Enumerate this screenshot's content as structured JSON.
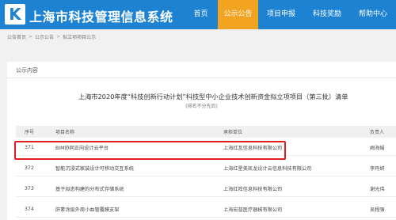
{
  "header": {
    "logo_letter": "K",
    "site_title": "上海市科技管理信息系统",
    "nav": [
      {
        "label": "首页",
        "active": false
      },
      {
        "label": "公示公告",
        "active": true
      },
      {
        "label": "项目申报",
        "active": false
      },
      {
        "label": "科技奖励",
        "active": false
      },
      {
        "label": "帮助中心",
        "active": false
      }
    ]
  },
  "breadcrumb": [
    "公告首页",
    "公示公告",
    "拟立项项目公示"
  ],
  "panel": {
    "title": "公示内容",
    "doc_title": "上海市2020年度“科技创新行动计划”科技型中小企业技术创新资金拟立项项目（第三批）清单",
    "doc_subtitle": "(排名不分先后)"
  },
  "table": {
    "headers": [
      "序号",
      "项目名称",
      "承担单位",
      "负责人"
    ],
    "rows": [
      {
        "num": "371",
        "name": "BIM协同正向设计云平台",
        "unit": "上海红瓦信息科技有限公司",
        "lead": "阙海娟"
      },
      {
        "num": "372",
        "name": "智能沉浸式家装设计可移动交互系统",
        "unit": "上海红星美凯龙设计云信息科技有限公司",
        "lead": "李丹妍"
      },
      {
        "num": "373",
        "name": "基于拟态构建的分布式存储系统",
        "unit": "上海红阵信息科技有限公司",
        "lead": "谢光伟"
      },
      {
        "num": "374",
        "name": "肝素涂层外周小血管覆膜支架",
        "unit": "上海宏普医疗器械有限公司",
        "lead": "吴程强"
      }
    ]
  },
  "colors": {
    "header_bg": "#1d82d2",
    "nav_active_bg": "#f2a320",
    "highlight": "#e01e1e"
  }
}
